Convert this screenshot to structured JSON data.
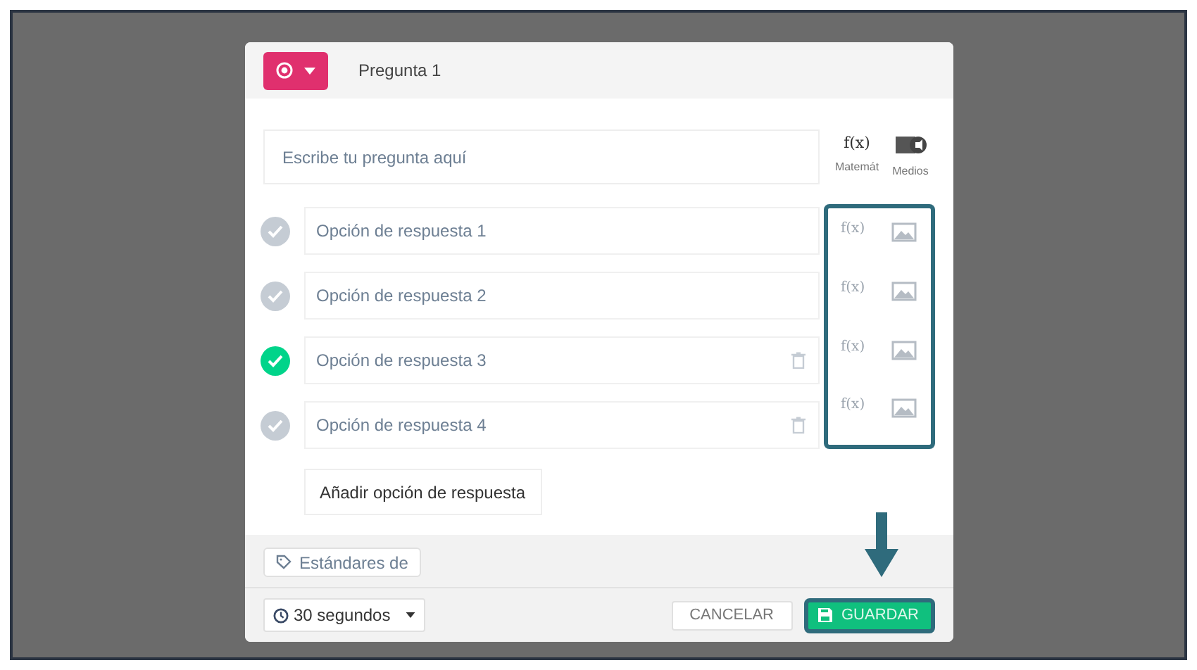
{
  "header": {
    "title": "Pregunta 1"
  },
  "question": {
    "placeholder": "Escribe tu pregunta aquí",
    "tools": [
      {
        "kind": "math",
        "glyph": "f(x)",
        "label": "Matemát"
      },
      {
        "kind": "media",
        "label": "Medios"
      }
    ]
  },
  "options": [
    {
      "placeholder": "Opción de respuesta 1",
      "correct": false,
      "deletable": false,
      "math_glyph": "f(x)"
    },
    {
      "placeholder": "Opción de respuesta 2",
      "correct": false,
      "deletable": false,
      "math_glyph": "f(x)"
    },
    {
      "placeholder": "Opción de respuesta 3",
      "correct": true,
      "deletable": true,
      "math_glyph": "f(x)"
    },
    {
      "placeholder": "Opción de respuesta 4",
      "correct": false,
      "deletable": true,
      "math_glyph": "f(x)"
    }
  ],
  "add_option": "Añadir opción de respuesta",
  "standards": "Estándares de",
  "timer": "30 segundos",
  "buttons": {
    "cancel": "CANCELAR",
    "save": "GUARDAR"
  }
}
